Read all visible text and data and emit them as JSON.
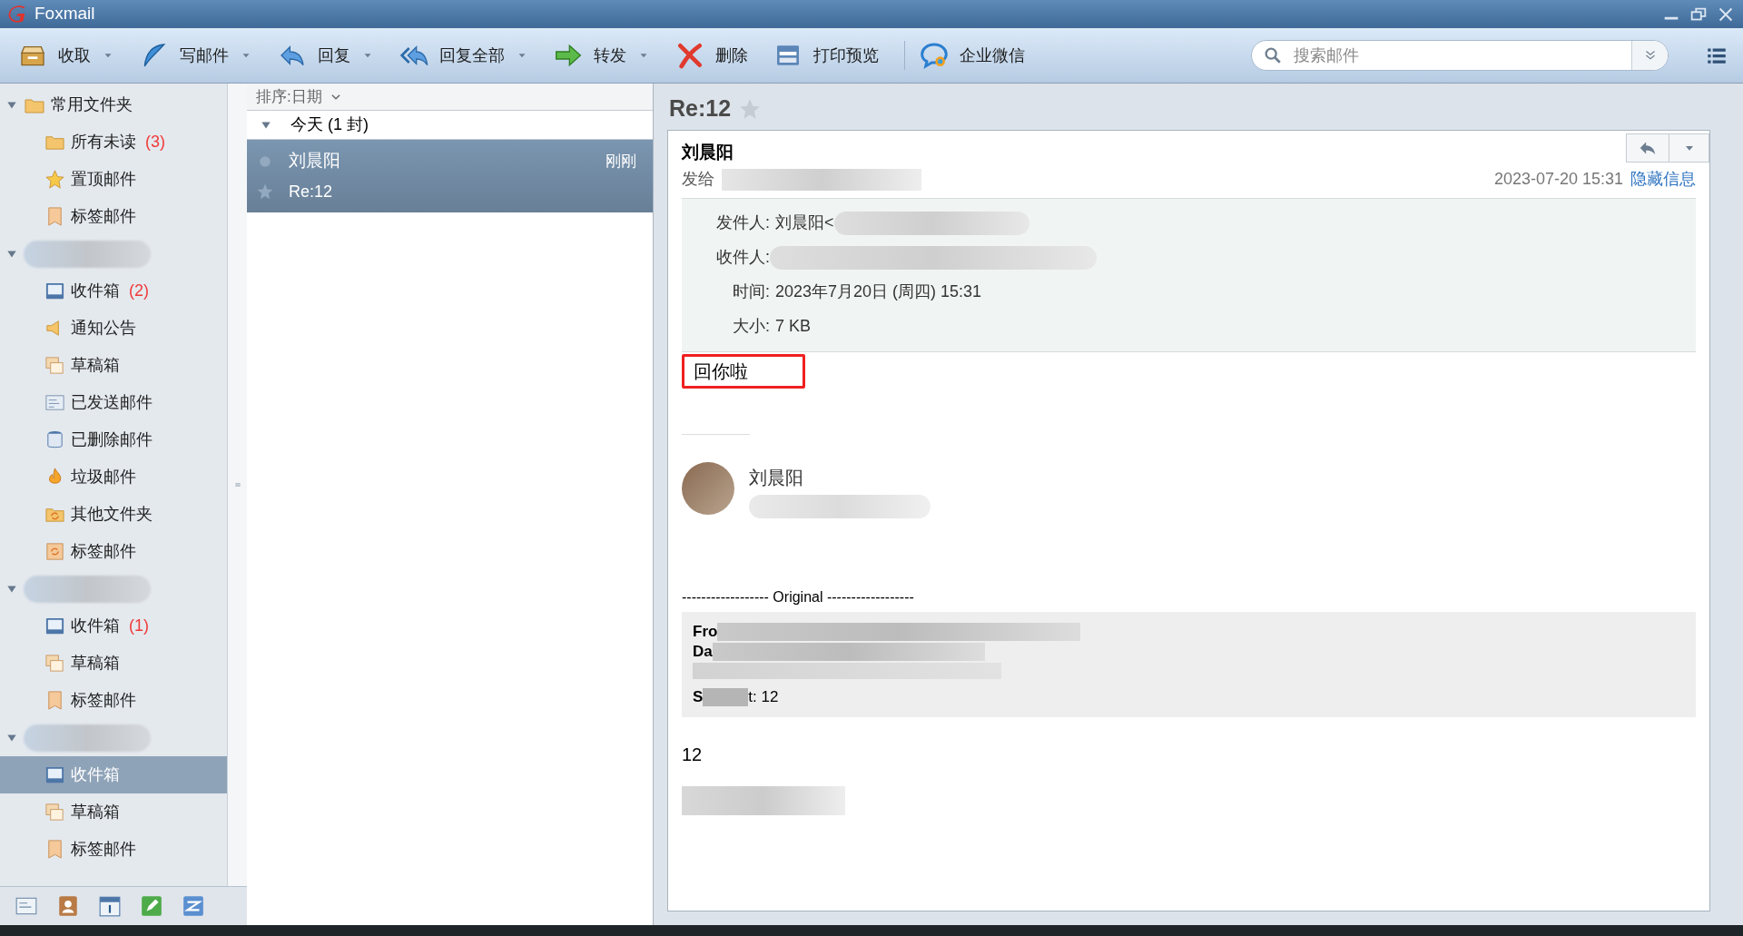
{
  "window": {
    "title": "Foxmail"
  },
  "toolbar": [
    {
      "label": "收取",
      "kind": "inbox-tray",
      "dropdown": true
    },
    {
      "label": "写邮件",
      "kind": "feather",
      "dropdown": true
    },
    {
      "label": "回复",
      "kind": "reply",
      "dropdown": true
    },
    {
      "label": "回复全部",
      "kind": "reply-all",
      "dropdown": true
    },
    {
      "label": "转发",
      "kind": "forward",
      "dropdown": true
    },
    {
      "label": "删除",
      "kind": "delete",
      "dropdown": false
    },
    {
      "label": "打印预览",
      "kind": "printer",
      "dropdown": false
    },
    {
      "label": "企业微信",
      "kind": "chat",
      "dropdown": false
    }
  ],
  "search": {
    "placeholder": "搜索邮件"
  },
  "sidebar": {
    "groups": [
      {
        "label": "常用文件夹",
        "redacted": false,
        "expanded": true,
        "children": [
          {
            "label": "所有未读",
            "count": "(3)",
            "kind": "folder",
            "selected": false
          },
          {
            "label": "置顶邮件",
            "kind": "star",
            "selected": false
          },
          {
            "label": "标签邮件",
            "kind": "tag",
            "selected": false
          }
        ]
      },
      {
        "redacted": true,
        "expanded": true,
        "children": [
          {
            "label": "收件箱",
            "count": "(2)",
            "kind": "inbox",
            "selected": false
          },
          {
            "label": "通知公告",
            "kind": "speaker",
            "selected": false
          },
          {
            "label": "草稿箱",
            "kind": "drafts",
            "selected": false
          },
          {
            "label": "已发送邮件",
            "kind": "sent",
            "selected": false
          },
          {
            "label": "已删除邮件",
            "kind": "trash",
            "selected": false
          },
          {
            "label": "垃圾邮件",
            "kind": "flame",
            "selected": false
          },
          {
            "label": "其他文件夹",
            "kind": "sync-folder",
            "selected": false
          },
          {
            "label": "标签邮件",
            "kind": "sync-tag",
            "selected": false
          }
        ]
      },
      {
        "redacted": true,
        "expanded": true,
        "children": [
          {
            "label": "收件箱",
            "count": "(1)",
            "kind": "inbox",
            "selected": false
          },
          {
            "label": "草稿箱",
            "kind": "drafts",
            "selected": false
          },
          {
            "label": "标签邮件",
            "kind": "tag",
            "selected": false
          }
        ]
      },
      {
        "redacted": true,
        "expanded": true,
        "children": [
          {
            "label": "收件箱",
            "kind": "inbox",
            "selected": true
          },
          {
            "label": "草稿箱",
            "kind": "drafts",
            "selected": false
          },
          {
            "label": "标签邮件",
            "kind": "tag",
            "selected": false
          }
        ]
      }
    ]
  },
  "message_list": {
    "sort": "排序:日期",
    "groups": [
      {
        "label": "今天 (1 封)",
        "expanded": true,
        "messages": [
          {
            "sender": "刘晨阳",
            "subject": "Re:12",
            "time": "刚刚",
            "selected": true,
            "starred": false
          }
        ]
      }
    ]
  },
  "reader": {
    "subject": "Re:12",
    "starred": false,
    "sender": "刘晨阳",
    "to_label": "发给",
    "datetime": "2023-07-20 15:31",
    "hide_link": "隐藏信息",
    "details": [
      {
        "label": "发件人:",
        "value": "刘晨阳<",
        "redacted": true
      },
      {
        "label": "收件人:",
        "redacted": true
      },
      {
        "label": "时间:",
        "value": "2023年7月20日 (周四) 15:31",
        "redacted": false
      },
      {
        "label": "大小:",
        "value": "7 KB",
        "redacted": false
      }
    ],
    "body_first_line": "回你啦",
    "highlighted": true,
    "signature": {
      "name": "刘晨阳"
    },
    "original_separator": "------------------ Original ------------------",
    "quote_lines": [
      "Fro",
      "Da",
      "S",
      "t: 12"
    ],
    "body_text": "12"
  }
}
